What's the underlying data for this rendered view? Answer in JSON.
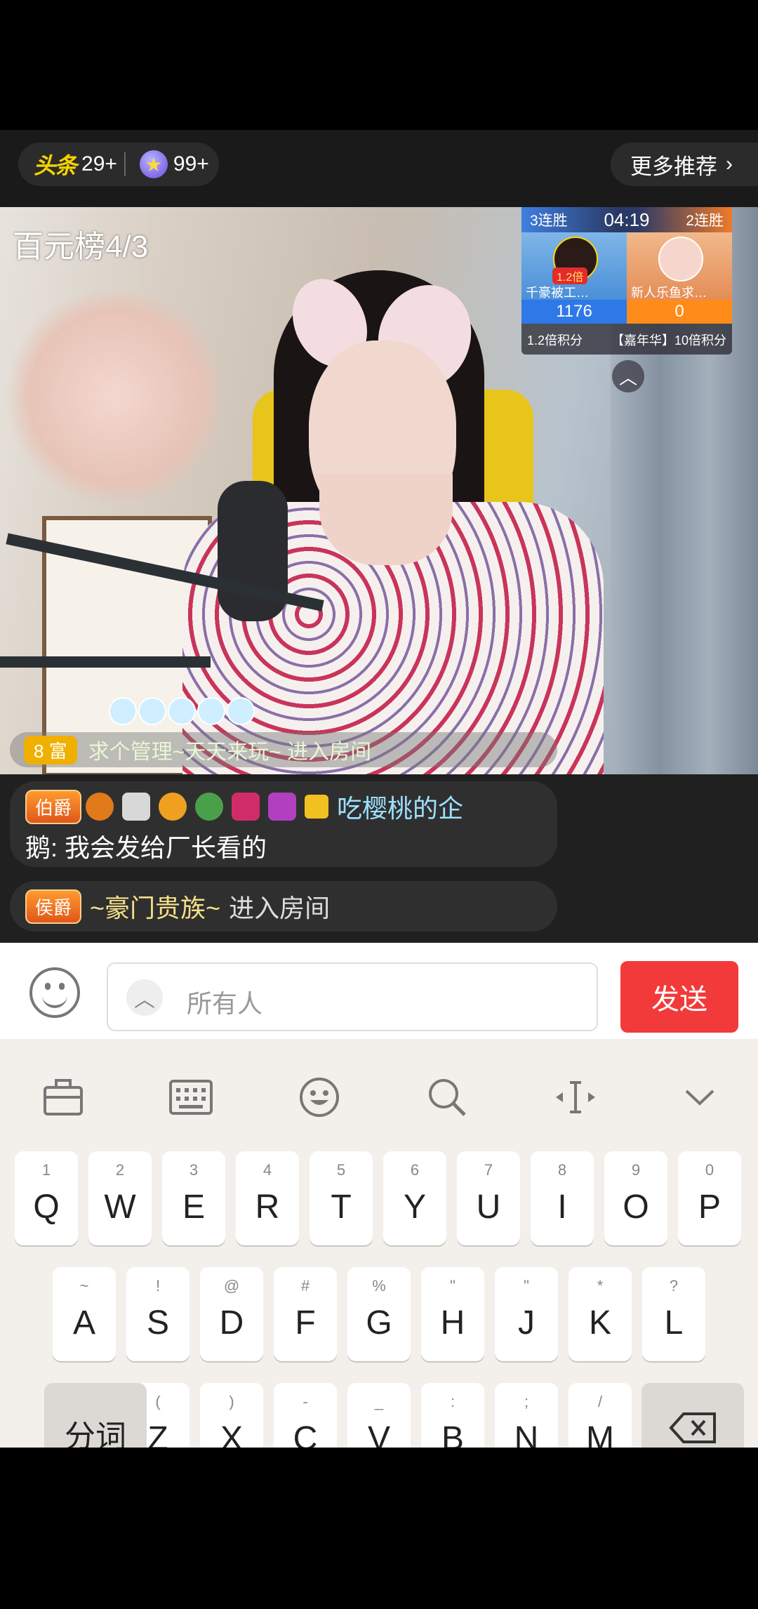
{
  "topbar": {
    "toutiao_logo": "头条",
    "toutiao_count": "29+",
    "star_count": "99+",
    "more_recommend": "更多推荐",
    "chevron": "chevron-right-icon"
  },
  "video": {
    "rank_label": "百元榜4/3",
    "pk": {
      "left_streak": "3连胜",
      "timer": "04:19",
      "right_streak": "2连胜",
      "left_multiplier": "1.2倍",
      "left_name": "千豪被工…",
      "right_name": "新人乐鱼求…",
      "left_score": "1176",
      "right_score": "0",
      "left_bonus": "1.2倍积分",
      "right_bonus": "【嘉年华】10倍积分"
    },
    "notice_level": "8",
    "notice_text": "求个管理~天天来玩~ 进入房间"
  },
  "chat": {
    "messages": [
      {
        "badge": "伯爵",
        "user": "吃樱桃的企",
        "text_line2": "鹅: 我会发给厂长看的"
      },
      {
        "badge": "侯爵",
        "user": "~豪门贵族~",
        "action": "进入房间"
      }
    ]
  },
  "input": {
    "placeholder": "所有人",
    "send_label": "发送"
  },
  "keyboard": {
    "row1": [
      {
        "n": "1",
        "l": "Q"
      },
      {
        "n": "2",
        "l": "W"
      },
      {
        "n": "3",
        "l": "E"
      },
      {
        "n": "4",
        "l": "R"
      },
      {
        "n": "5",
        "l": "T"
      },
      {
        "n": "6",
        "l": "Y"
      },
      {
        "n": "7",
        "l": "U"
      },
      {
        "n": "8",
        "l": "I"
      },
      {
        "n": "9",
        "l": "O"
      },
      {
        "n": "0",
        "l": "P"
      }
    ],
    "row2": [
      {
        "n": "~",
        "l": "A"
      },
      {
        "n": "!",
        "l": "S"
      },
      {
        "n": "@",
        "l": "D"
      },
      {
        "n": "#",
        "l": "F"
      },
      {
        "n": "%",
        "l": "G"
      },
      {
        "n": "\"",
        "l": "H"
      },
      {
        "n": "\"",
        "l": "J"
      },
      {
        "n": "*",
        "l": "K"
      },
      {
        "n": "?",
        "l": "L"
      }
    ],
    "row3": [
      {
        "n": "(",
        "l": "Z"
      },
      {
        "n": ")",
        "l": "X"
      },
      {
        "n": "-",
        "l": "C"
      },
      {
        "n": "_",
        "l": "V"
      },
      {
        "n": ":",
        "l": "B"
      },
      {
        "n": ";",
        "l": "N"
      },
      {
        "n": "/",
        "l": "M"
      }
    ],
    "fenci": "分词"
  }
}
